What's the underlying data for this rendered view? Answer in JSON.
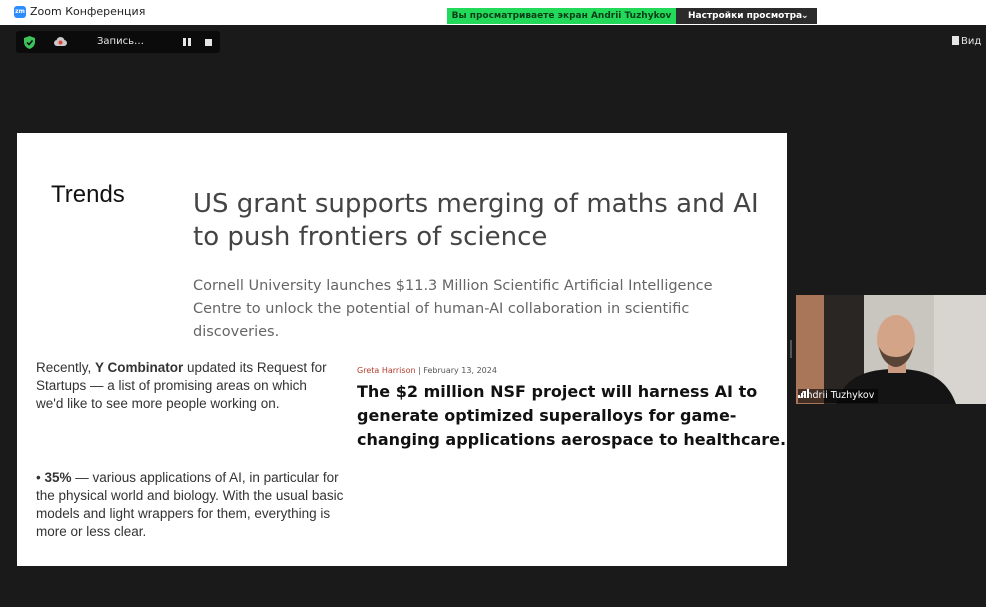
{
  "window": {
    "app_title": "Zoom Конференция"
  },
  "share_bar": {
    "banner": "Вы просматриваете экран Andrii Tuzhykov",
    "view_options": "Настройки просмотра",
    "chevron": "⌄"
  },
  "recording": {
    "label": "Запись…"
  },
  "toolbar": {
    "view_label": "Вид"
  },
  "slide": {
    "section": "Trends",
    "headline": "US grant supports merging of maths and AI to push frontiers of science",
    "subtitle": "Cornell University launches $11.3 Million Scientific Artificial Intelligence Centre to unlock the potential of human-AI collaboration in scientific discoveries.",
    "yc_text": {
      "before": "Recently, ",
      "bold": "Y Combinator",
      "after": " updated its Request for Startups — a list of promising areas on which we'd like to see more people working on."
    },
    "bullet": {
      "prefix": "• ",
      "bold": "35%",
      "text": " — various applications of AI, in particular for the physical world and biology. With the usual basic models and light wrappers for them, everything is more or less clear."
    },
    "byline": {
      "author": "Greta Harrison",
      "separator": " | ",
      "date": "February 13, 2024"
    },
    "nsf_headline": "The $2 million NSF project will harness AI to generate optimized superalloys for game-changing applications aerospace to healthcare."
  },
  "participant": {
    "name": "Andrii Tuzhykov"
  },
  "colors": {
    "share_green": "#23d959",
    "background": "#1a1a1a",
    "accent_author": "#b43c2a"
  },
  "icons": [
    "zoom-logo-icon",
    "shield-icon",
    "cloud-icon",
    "pause-icon",
    "stop-icon",
    "view-icon",
    "signal-icon",
    "chevron-down-icon"
  ]
}
